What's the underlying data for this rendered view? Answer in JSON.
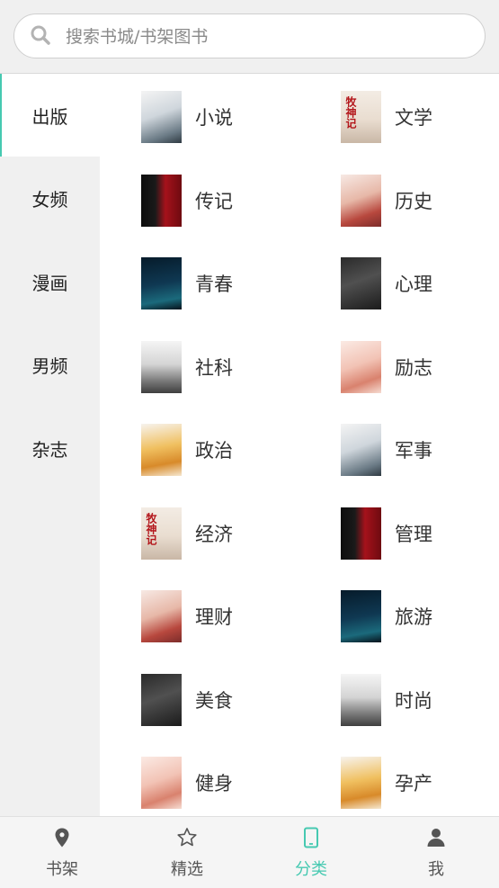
{
  "search": {
    "placeholder": "搜索书城/书架图书"
  },
  "sidebar": {
    "items": [
      {
        "label": "出版",
        "active": true
      },
      {
        "label": "女频"
      },
      {
        "label": "漫画"
      },
      {
        "label": "男频"
      },
      {
        "label": "杂志"
      }
    ]
  },
  "categories": [
    {
      "label": "小说",
      "cover": "cover-ink-moon",
      "cover_title": ""
    },
    {
      "label": "文学",
      "cover": "cover-red-title",
      "cover_title": "牧神记"
    },
    {
      "label": "传记",
      "cover": "cover-black-red",
      "cover_title": ""
    },
    {
      "label": "历史",
      "cover": "cover-woman-portrait",
      "cover_title": ""
    },
    {
      "label": "青春",
      "cover": "cover-dark-blue",
      "cover_title": ""
    },
    {
      "label": "心理",
      "cover": "cover-dark-figure",
      "cover_title": ""
    },
    {
      "label": "社科",
      "cover": "cover-grey-city",
      "cover_title": ""
    },
    {
      "label": "励志",
      "cover": "cover-pink-flowers",
      "cover_title": ""
    },
    {
      "label": "政治",
      "cover": "cover-yellow-dress",
      "cover_title": ""
    },
    {
      "label": "军事",
      "cover": "cover-ink-moon",
      "cover_title": ""
    },
    {
      "label": "经济",
      "cover": "cover-red-title",
      "cover_title": "牧神记"
    },
    {
      "label": "管理",
      "cover": "cover-black-red",
      "cover_title": ""
    },
    {
      "label": "理财",
      "cover": "cover-woman-portrait",
      "cover_title": ""
    },
    {
      "label": "旅游",
      "cover": "cover-dark-blue",
      "cover_title": ""
    },
    {
      "label": "美食",
      "cover": "cover-dark-figure",
      "cover_title": ""
    },
    {
      "label": "时尚",
      "cover": "cover-grey-city",
      "cover_title": ""
    },
    {
      "label": "健身",
      "cover": "cover-pink-flowers",
      "cover_title": ""
    },
    {
      "label": "孕产",
      "cover": "cover-yellow-dress",
      "cover_title": ""
    }
  ],
  "tabbar": {
    "items": [
      {
        "label": "书架",
        "icon": "map-pin-icon"
      },
      {
        "label": "精选",
        "icon": "star-icon"
      },
      {
        "label": "分类",
        "icon": "tablet-icon",
        "active": true
      },
      {
        "label": "我",
        "icon": "user-icon"
      }
    ]
  },
  "colors": {
    "accent": "#46c9b1",
    "background": "#f0f0f0",
    "text": "#333333"
  }
}
